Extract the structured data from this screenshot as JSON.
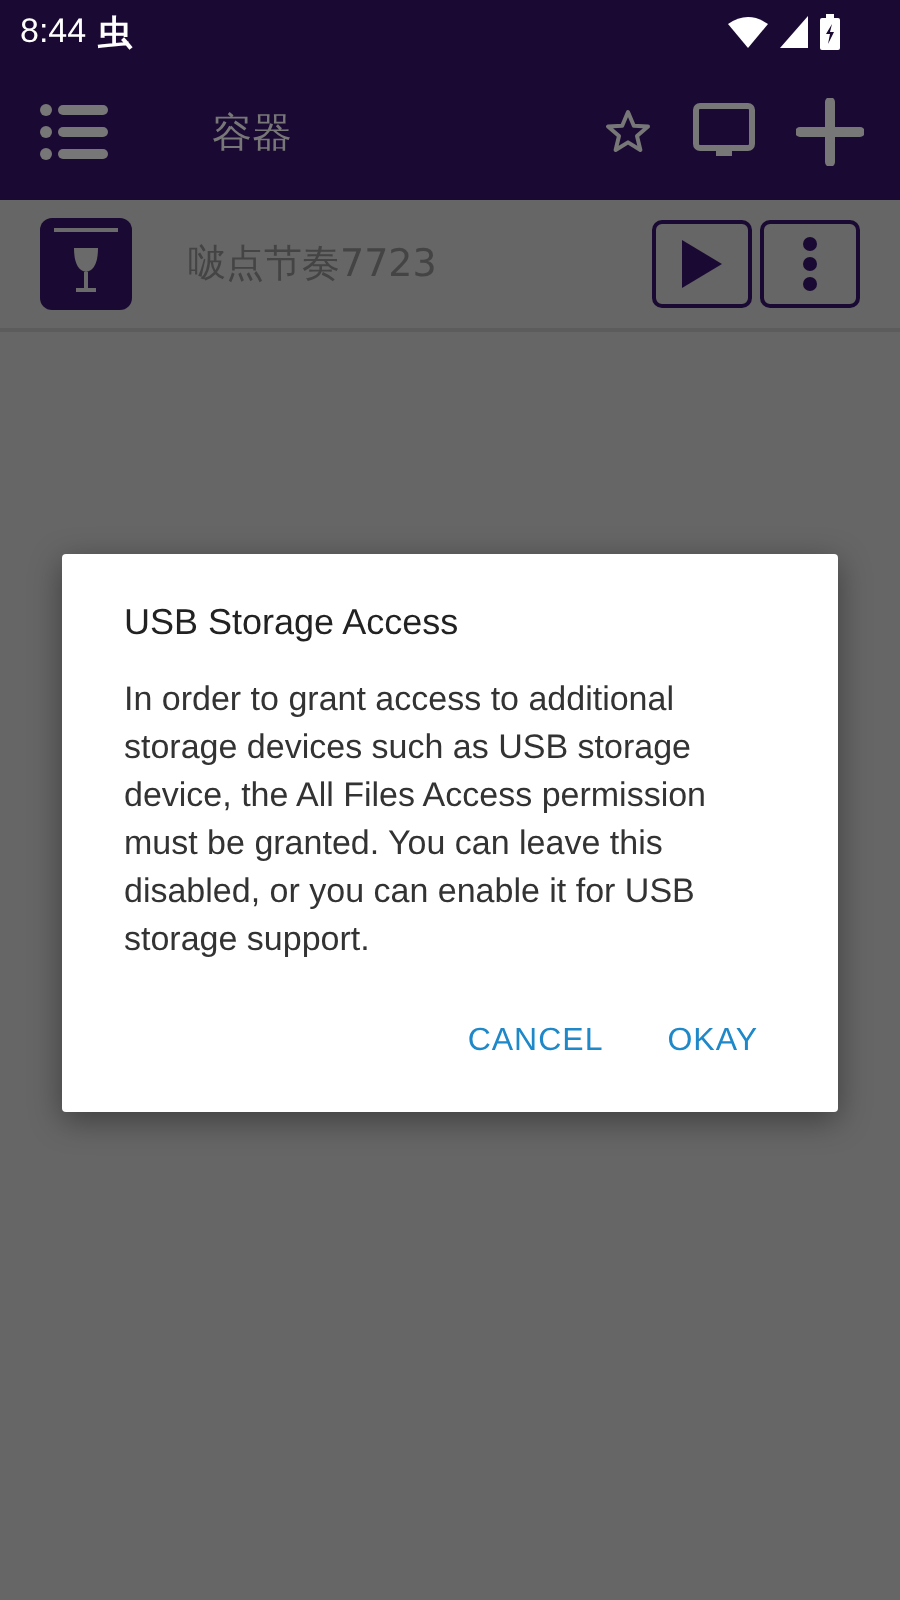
{
  "status_bar": {
    "time": "8:44",
    "notification": "虫"
  },
  "app_bar": {
    "title": "容器"
  },
  "containers": [
    {
      "name": "啵点节奏7723"
    }
  ],
  "dialog": {
    "title": "USB Storage Access",
    "message": "In order to grant access to additional storage devices such as USB storage device, the All Files Access permission must be granted. You can leave this disabled, or you can enable it for USB storage support.",
    "buttons": [
      "CANCEL",
      "OKAY"
    ]
  }
}
